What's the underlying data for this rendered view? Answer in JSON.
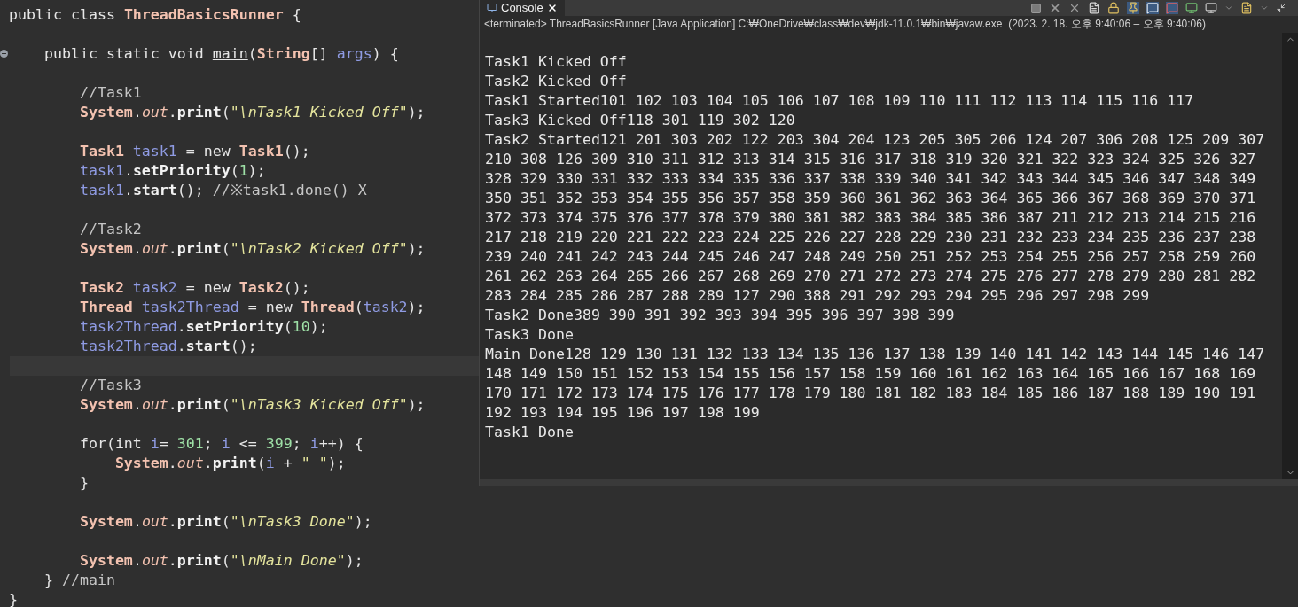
{
  "editor": {
    "lines": [
      {
        "kind": "code",
        "tokens": [
          {
            "text": "public class ",
            "kind": "plain"
          },
          {
            "text": "ThreadBasicsRunner",
            "kind": "type"
          },
          {
            "text": " {",
            "kind": "plain"
          }
        ]
      },
      {
        "kind": "blank"
      },
      {
        "kind": "folding",
        "tokens": [
          {
            "text": "    public static void ",
            "kind": "plain"
          },
          {
            "text": "main",
            "kind": "decl"
          },
          {
            "text": "(",
            "kind": "plain"
          },
          {
            "text": "String",
            "kind": "type"
          },
          {
            "text": "[] ",
            "kind": "plain"
          },
          {
            "text": "args",
            "kind": "var"
          },
          {
            "text": ") {",
            "kind": "plain"
          }
        ]
      },
      {
        "kind": "blank"
      },
      {
        "kind": "code",
        "tokens": [
          {
            "text": "        //Task1",
            "kind": "comment"
          }
        ]
      },
      {
        "kind": "code",
        "tokens": [
          {
            "text": "        System",
            "kind": "type"
          },
          {
            "text": ".",
            "kind": "plain"
          },
          {
            "text": "out",
            "kind": "field"
          },
          {
            "text": ".",
            "kind": "plain"
          },
          {
            "text": "print",
            "kind": "method"
          },
          {
            "text": "(",
            "kind": "plain"
          },
          {
            "text": "\"\\nTask1 Kicked Off\"",
            "kind": "string"
          },
          {
            "text": ");",
            "kind": "plain"
          }
        ]
      },
      {
        "kind": "blank"
      },
      {
        "kind": "code",
        "tokens": [
          {
            "text": "        Task1",
            "kind": "type"
          },
          {
            "text": " task1",
            "kind": "var"
          },
          {
            "text": " = new ",
            "kind": "plain"
          },
          {
            "text": "Task1",
            "kind": "type"
          },
          {
            "text": "();",
            "kind": "plain"
          }
        ]
      },
      {
        "kind": "code",
        "tokens": [
          {
            "text": "        task1",
            "kind": "var"
          },
          {
            "text": ".",
            "kind": "plain"
          },
          {
            "text": "setPriority",
            "kind": "method"
          },
          {
            "text": "(",
            "kind": "plain"
          },
          {
            "text": "1",
            "kind": "number"
          },
          {
            "text": ");",
            "kind": "plain"
          }
        ]
      },
      {
        "kind": "code",
        "tokens": [
          {
            "text": "        task1",
            "kind": "var"
          },
          {
            "text": ".",
            "kind": "plain"
          },
          {
            "text": "start",
            "kind": "method"
          },
          {
            "text": "(); ",
            "kind": "plain"
          },
          {
            "text": "//※task1.done() X",
            "kind": "comment"
          }
        ]
      },
      {
        "kind": "blank"
      },
      {
        "kind": "code",
        "tokens": [
          {
            "text": "        //Task2",
            "kind": "comment"
          }
        ]
      },
      {
        "kind": "code",
        "tokens": [
          {
            "text": "        System",
            "kind": "type"
          },
          {
            "text": ".",
            "kind": "plain"
          },
          {
            "text": "out",
            "kind": "field"
          },
          {
            "text": ".",
            "kind": "plain"
          },
          {
            "text": "print",
            "kind": "method"
          },
          {
            "text": "(",
            "kind": "plain"
          },
          {
            "text": "\"\\nTask2 Kicked Off\"",
            "kind": "string"
          },
          {
            "text": ");",
            "kind": "plain"
          }
        ]
      },
      {
        "kind": "blank"
      },
      {
        "kind": "code",
        "tokens": [
          {
            "text": "        Task2",
            "kind": "type"
          },
          {
            "text": " task2",
            "kind": "var"
          },
          {
            "text": " = new ",
            "kind": "plain"
          },
          {
            "text": "Task2",
            "kind": "type"
          },
          {
            "text": "();",
            "kind": "plain"
          }
        ]
      },
      {
        "kind": "code",
        "tokens": [
          {
            "text": "        Thread",
            "kind": "type"
          },
          {
            "text": " task2Thread",
            "kind": "var"
          },
          {
            "text": " = new ",
            "kind": "plain"
          },
          {
            "text": "Thread",
            "kind": "type"
          },
          {
            "text": "(",
            "kind": "plain"
          },
          {
            "text": "task2",
            "kind": "var"
          },
          {
            "text": ");",
            "kind": "plain"
          }
        ]
      },
      {
        "kind": "code",
        "tokens": [
          {
            "text": "        task2Thread",
            "kind": "var"
          },
          {
            "text": ".",
            "kind": "plain"
          },
          {
            "text": "setPriority",
            "kind": "method"
          },
          {
            "text": "(",
            "kind": "plain"
          },
          {
            "text": "10",
            "kind": "number"
          },
          {
            "text": ");",
            "kind": "plain"
          }
        ]
      },
      {
        "kind": "code",
        "tokens": [
          {
            "text": "        task2Thread",
            "kind": "var"
          },
          {
            "text": ".",
            "kind": "plain"
          },
          {
            "text": "start",
            "kind": "method"
          },
          {
            "text": "();",
            "kind": "plain"
          }
        ]
      },
      {
        "kind": "current"
      },
      {
        "kind": "code",
        "tokens": [
          {
            "text": "        //Task3",
            "kind": "comment"
          }
        ]
      },
      {
        "kind": "code",
        "tokens": [
          {
            "text": "        System",
            "kind": "type"
          },
          {
            "text": ".",
            "kind": "plain"
          },
          {
            "text": "out",
            "kind": "field"
          },
          {
            "text": ".",
            "kind": "plain"
          },
          {
            "text": "print",
            "kind": "method"
          },
          {
            "text": "(",
            "kind": "plain"
          },
          {
            "text": "\"\\nTask3 Kicked Off\"",
            "kind": "string"
          },
          {
            "text": ");",
            "kind": "plain"
          }
        ]
      },
      {
        "kind": "blank"
      },
      {
        "kind": "code",
        "tokens": [
          {
            "text": "        for(int ",
            "kind": "plain"
          },
          {
            "text": "i",
            "kind": "var"
          },
          {
            "text": "= ",
            "kind": "plain"
          },
          {
            "text": "301",
            "kind": "number"
          },
          {
            "text": "; ",
            "kind": "plain"
          },
          {
            "text": "i",
            "kind": "var"
          },
          {
            "text": " <= ",
            "kind": "plain"
          },
          {
            "text": "399",
            "kind": "number"
          },
          {
            "text": "; ",
            "kind": "plain"
          },
          {
            "text": "i",
            "kind": "var"
          },
          {
            "text": "++) {",
            "kind": "plain"
          }
        ]
      },
      {
        "kind": "code",
        "tokens": [
          {
            "text": "            System",
            "kind": "type"
          },
          {
            "text": ".",
            "kind": "plain"
          },
          {
            "text": "out",
            "kind": "field"
          },
          {
            "text": ".",
            "kind": "plain"
          },
          {
            "text": "print",
            "kind": "method"
          },
          {
            "text": "(",
            "kind": "plain"
          },
          {
            "text": "i",
            "kind": "var"
          },
          {
            "text": " + ",
            "kind": "plain"
          },
          {
            "text": "\" \"",
            "kind": "string"
          },
          {
            "text": ");",
            "kind": "plain"
          }
        ]
      },
      {
        "kind": "code",
        "tokens": [
          {
            "text": "        }",
            "kind": "plain"
          }
        ]
      },
      {
        "kind": "blank"
      },
      {
        "kind": "code",
        "tokens": [
          {
            "text": "        System",
            "kind": "type"
          },
          {
            "text": ".",
            "kind": "plain"
          },
          {
            "text": "out",
            "kind": "field"
          },
          {
            "text": ".",
            "kind": "plain"
          },
          {
            "text": "print",
            "kind": "method"
          },
          {
            "text": "(",
            "kind": "plain"
          },
          {
            "text": "\"\\nTask3 Done\"",
            "kind": "string"
          },
          {
            "text": ");",
            "kind": "plain"
          }
        ]
      },
      {
        "kind": "blank"
      },
      {
        "kind": "code",
        "tokens": [
          {
            "text": "        System",
            "kind": "type"
          },
          {
            "text": ".",
            "kind": "plain"
          },
          {
            "text": "out",
            "kind": "field"
          },
          {
            "text": ".",
            "kind": "plain"
          },
          {
            "text": "print",
            "kind": "method"
          },
          {
            "text": "(",
            "kind": "plain"
          },
          {
            "text": "\"\\nMain Done\"",
            "kind": "string"
          },
          {
            "text": ");",
            "kind": "plain"
          }
        ]
      },
      {
        "kind": "code",
        "tokens": [
          {
            "text": "    } ",
            "kind": "plain"
          },
          {
            "text": "//main",
            "kind": "comment"
          }
        ]
      },
      {
        "kind": "code",
        "tokens": [
          {
            "text": "}",
            "kind": "plain"
          }
        ]
      }
    ]
  },
  "console": {
    "tabs": [
      {
        "label": "Console",
        "selected": true
      }
    ],
    "description": "<terminated> ThreadBasicsRunner [Java Application] C:₩OneDrive₩class₩dev₩jdk-11.0.1₩bin₩javaw.exe  (2023. 2. 18. 오후 9:40:06 – 오후 9:40:06)",
    "output": [
      "Task1 Kicked Off",
      "Task2 Kicked Off",
      "Task1 Started101 102 103 104 105 106 107 108 109 110 111 112 113 114 115 116 117",
      "Task3 Kicked Off118 301 119 302 120",
      "Task2 Started121 201 303 202 122 203 304 204 123 205 305 206 124 207 306 208 125 209 307",
      "210 308 126 309 310 311 312 313 314 315 316 317 318 319 320 321 322 323 324 325 326 327",
      "328 329 330 331 332 333 334 335 336 337 338 339 340 341 342 343 344 345 346 347 348 349",
      "350 351 352 353 354 355 356 357 358 359 360 361 362 363 364 365 366 367 368 369 370 371",
      "372 373 374 375 376 377 378 379 380 381 382 383 384 385 386 387 211 212 213 214 215 216",
      "217 218 219 220 221 222 223 224 225 226 227 228 229 230 231 232 233 234 235 236 237 238",
      "239 240 241 242 243 244 245 246 247 248 249 250 251 252 253 254 255 256 257 258 259 260",
      "261 262 263 264 265 266 267 268 269 270 271 272 273 274 275 276 277 278 279 280 281 282",
      "283 284 285 286 287 288 289 127 290 388 291 292 293 294 295 296 297 298 299",
      "Task2 Done389 390 391 392 393 394 395 396 397 398 399",
      "Task3 Done",
      "Main Done128 129 130 131 132 133 134 135 136 137 138 139 140 141 142 143 144 145 146 147",
      "148 149 150 151 152 153 154 155 156 157 158 159 160 161 162 163 164 165 166 167 168 169",
      "170 171 172 173 174 175 176 177 178 179 180 181 182 183 184 185 186 187 188 189 190 191",
      "192 193 194 195 196 197 198 199",
      "Task1 Done"
    ]
  }
}
